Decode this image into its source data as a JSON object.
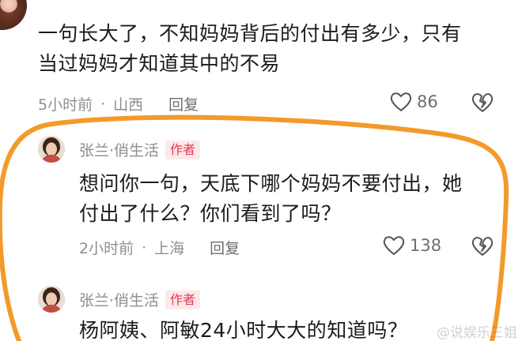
{
  "comment1": {
    "text_line1": "一句长大了，不知妈妈背后的付出有多少，只有",
    "text_line2": "当过妈妈才知道其中的不易",
    "time": "5小时前",
    "location": "山西",
    "reply_label": "回复",
    "like_count": "86"
  },
  "comment2": {
    "author": "张兰·俏生活",
    "badge": "作者",
    "text_line1": "想问你一句，天底下哪个妈妈不要付出，她",
    "text_line2": "付出了什么？你们看到了吗？",
    "time": "2小时前",
    "location": "上海",
    "reply_label": "回复",
    "like_count": "138"
  },
  "comment3": {
    "author": "张兰·俏生活",
    "badge": "作者",
    "text_line1": "杨阿姨、阿敏24小时大大的知道吗？"
  },
  "watermark": "@说娱乐三姐",
  "colors": {
    "highlight_circle": "#f39a2b",
    "badge_bg": "#fde8ea",
    "badge_text": "#e5394f",
    "meta_text": "#8e8e93"
  }
}
